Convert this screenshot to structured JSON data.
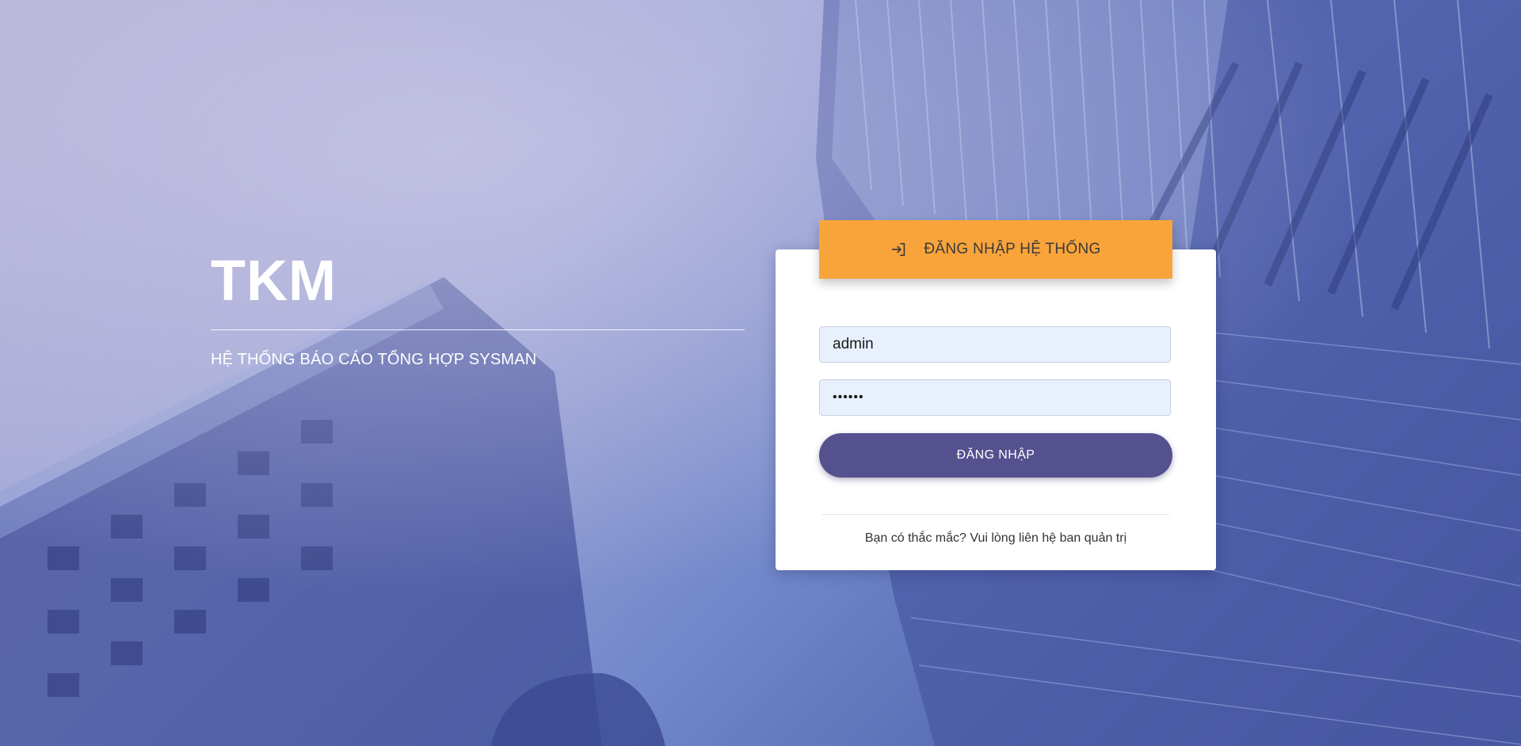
{
  "brand": {
    "title": "TKM",
    "subtitle": "HỆ THỐNG BÁO CÁO TỔNG HỢP SYSMAN"
  },
  "login_card": {
    "header_label": "ĐĂNG NHẬP HỆ THỐNG",
    "header_icon": "login-arrow-icon",
    "username_value": "admin",
    "password_value": "••••••",
    "submit_label": "ĐĂNG NHẬP",
    "help_text": "Bạn có thắc mắc? Vui lòng liên hệ ban quản trị"
  },
  "colors": {
    "header_accent": "#f9a43b",
    "button": "#55518f",
    "input_bg": "#e8f0fe",
    "background": "#6f86c9"
  }
}
